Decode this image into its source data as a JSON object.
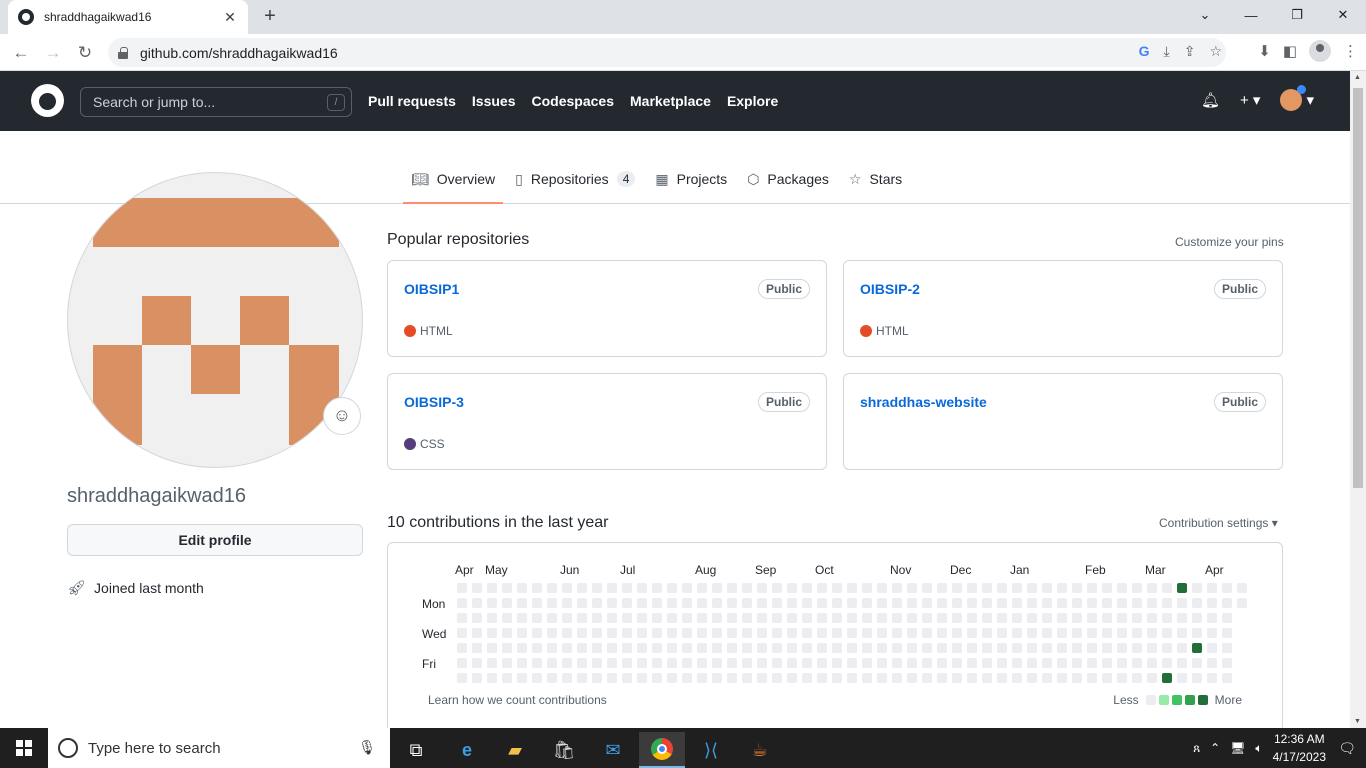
{
  "browser": {
    "tab_title": "shraddhagaikwad16",
    "tab_close": "✕",
    "new_tab": "+",
    "url": "github.com/shraddhagaikwad16"
  },
  "github_header": {
    "search_placeholder": "Search or jump to...",
    "search_shortcut": "/",
    "nav": [
      "Pull requests",
      "Issues",
      "Codespaces",
      "Marketplace",
      "Explore"
    ]
  },
  "profile_nav": {
    "tabs": [
      {
        "label": "Overview",
        "icon": "book-icon"
      },
      {
        "label": "Repositories",
        "icon": "repo-icon",
        "count": "4"
      },
      {
        "label": "Projects",
        "icon": "table-icon"
      },
      {
        "label": "Packages",
        "icon": "package-icon"
      },
      {
        "label": "Stars",
        "icon": "star-icon"
      }
    ]
  },
  "profile": {
    "username": "shraddhagaikwad16",
    "edit_profile": "Edit profile",
    "joined": "Joined last month"
  },
  "popular": {
    "title": "Popular repositories",
    "customize": "Customize your pins",
    "repos": [
      {
        "name": "OIBSIP1",
        "visibility": "Public",
        "language": "HTML",
        "lang_color": "#e34c26"
      },
      {
        "name": "OIBSIP-2",
        "visibility": "Public",
        "language": "HTML",
        "lang_color": "#e34c26"
      },
      {
        "name": "OIBSIP-3",
        "visibility": "Public",
        "language": "CSS",
        "lang_color": "#563d7c"
      },
      {
        "name": "shraddhas-website",
        "visibility": "Public",
        "language": "",
        "lang_color": ""
      }
    ]
  },
  "contributions": {
    "title": "10 contributions in the last year",
    "settings": "Contribution settings ▾",
    "months": [
      "Apr",
      "May",
      "Jun",
      "Jul",
      "Aug",
      "Sep",
      "Oct",
      "Nov",
      "Dec",
      "Jan",
      "Feb",
      "Mar",
      "Apr"
    ],
    "days": [
      "Mon",
      "Wed",
      "Fri"
    ],
    "learn": "Learn how we count contributions",
    "less": "Less",
    "more": "More",
    "colors": [
      "#ebedf0",
      "#9be9a8",
      "#40c463",
      "#30a14e",
      "#216e39"
    ]
  },
  "taskbar": {
    "search_placeholder": "Type here to search",
    "time": "12:36 AM",
    "date": "4/17/2023"
  }
}
